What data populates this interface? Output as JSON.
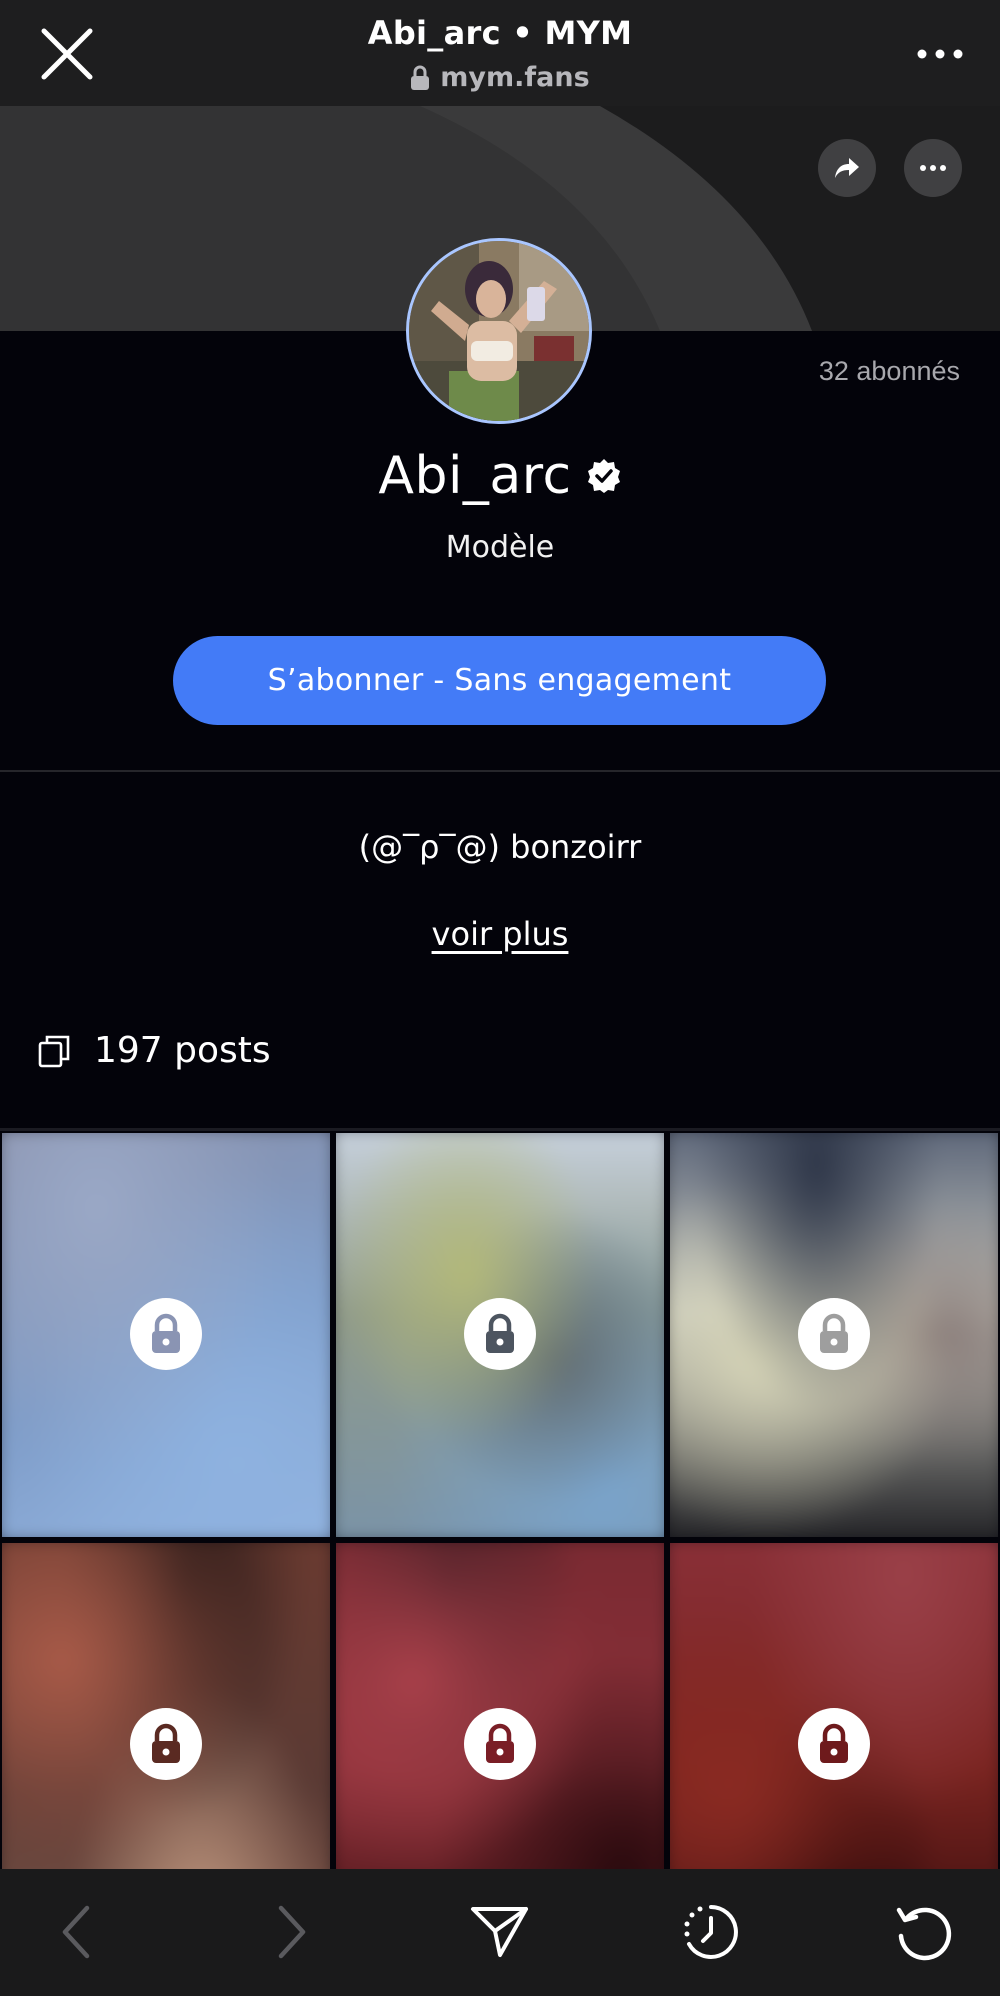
{
  "browser": {
    "title": "Abi_arc • MYM",
    "url": "mym.fans"
  },
  "profile": {
    "subscribers": "32 abonnés",
    "name": "Abi_arc",
    "role": "Modèle",
    "subscribe_label": "S’abonner - Sans engagement",
    "bio": "(@‾ρ‾@) bonzoirr",
    "see_more_label": "voir plus",
    "posts_count": "197 posts"
  },
  "colors": {
    "accent": "#437bf7",
    "background": "#03030a",
    "avatar_ring": "#a9c6ff"
  },
  "posts": [
    {
      "locked": true,
      "icon": "lock-icon",
      "lock_color": "#8a94b3"
    },
    {
      "locked": true,
      "icon": "lock-icon",
      "lock_color": "#4d5560"
    },
    {
      "locked": true,
      "icon": "lock-icon",
      "lock_color": "#9e9e9e"
    },
    {
      "locked": true,
      "icon": "lock-icon",
      "lock_color": "#5a2a22"
    },
    {
      "locked": true,
      "icon": "lock-icon",
      "lock_color": "#7a1e26"
    },
    {
      "locked": true,
      "icon": "lock-icon",
      "lock_color": "#6e1a1c"
    }
  ],
  "toolbar": {
    "icons": [
      "back-icon",
      "forward-icon",
      "send-icon",
      "history-icon",
      "reload-icon"
    ]
  }
}
